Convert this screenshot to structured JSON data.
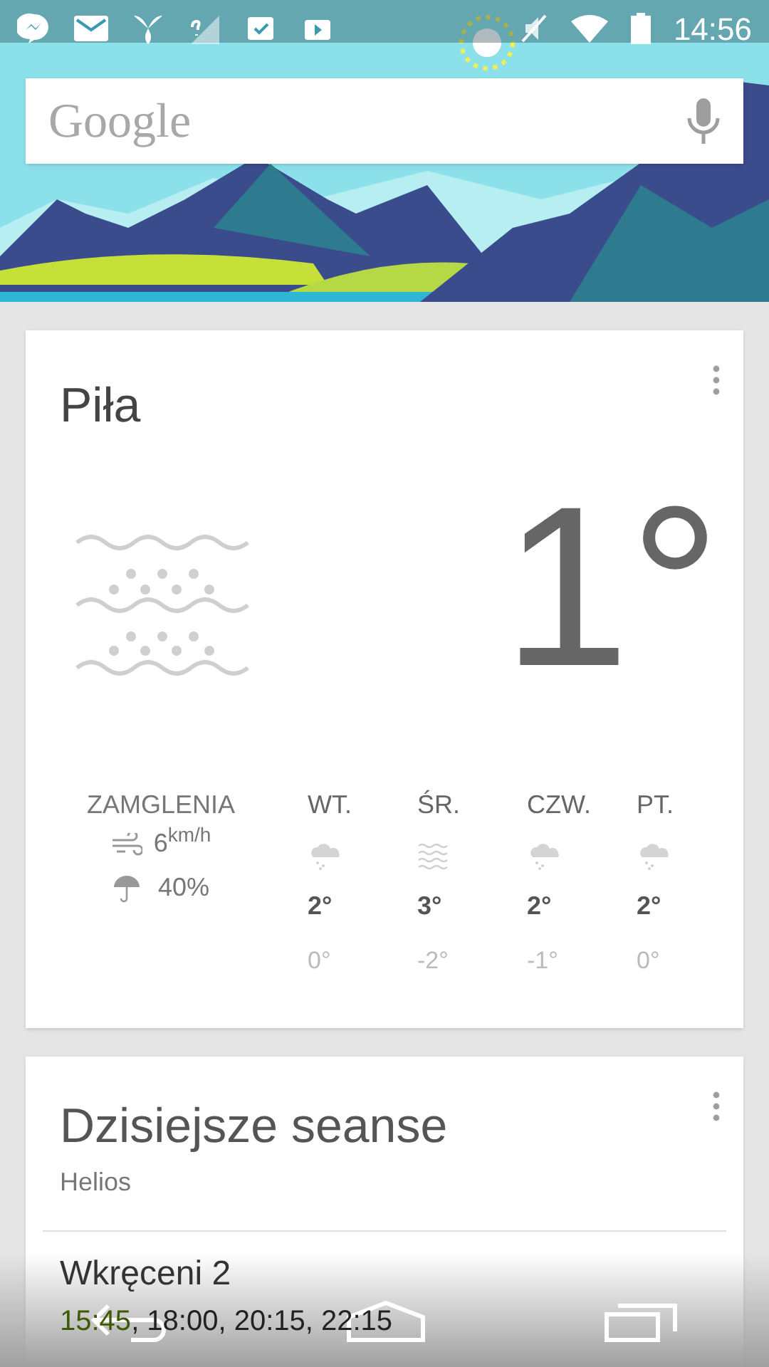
{
  "status_bar": {
    "time": "14:56"
  },
  "search": {
    "placeholder": "Google"
  },
  "weather": {
    "city": "Piła",
    "temperature": "1°",
    "condition": "ZAMGLENIA",
    "wind_value": "6",
    "wind_unit": "km/h",
    "precipitation": "40%",
    "forecast": [
      {
        "day": "WT.",
        "kind": "snow",
        "high": "2°",
        "low": "0°"
      },
      {
        "day": "ŚR.",
        "kind": "fog",
        "high": "3°",
        "low": "-2°"
      },
      {
        "day": "CZW.",
        "kind": "snow",
        "high": "2°",
        "low": "-1°"
      },
      {
        "day": "PT.",
        "kind": "snow",
        "high": "2°",
        "low": "0°"
      }
    ]
  },
  "movies": {
    "title": "Dzisiejsze seanse",
    "cinema": "Helios",
    "film": "Wkręceni 2",
    "showtimes": [
      {
        "text": "15:45",
        "highlighted": true
      },
      {
        "text": ", 18:00, 20:15, 22:15",
        "highlighted": false
      }
    ]
  }
}
